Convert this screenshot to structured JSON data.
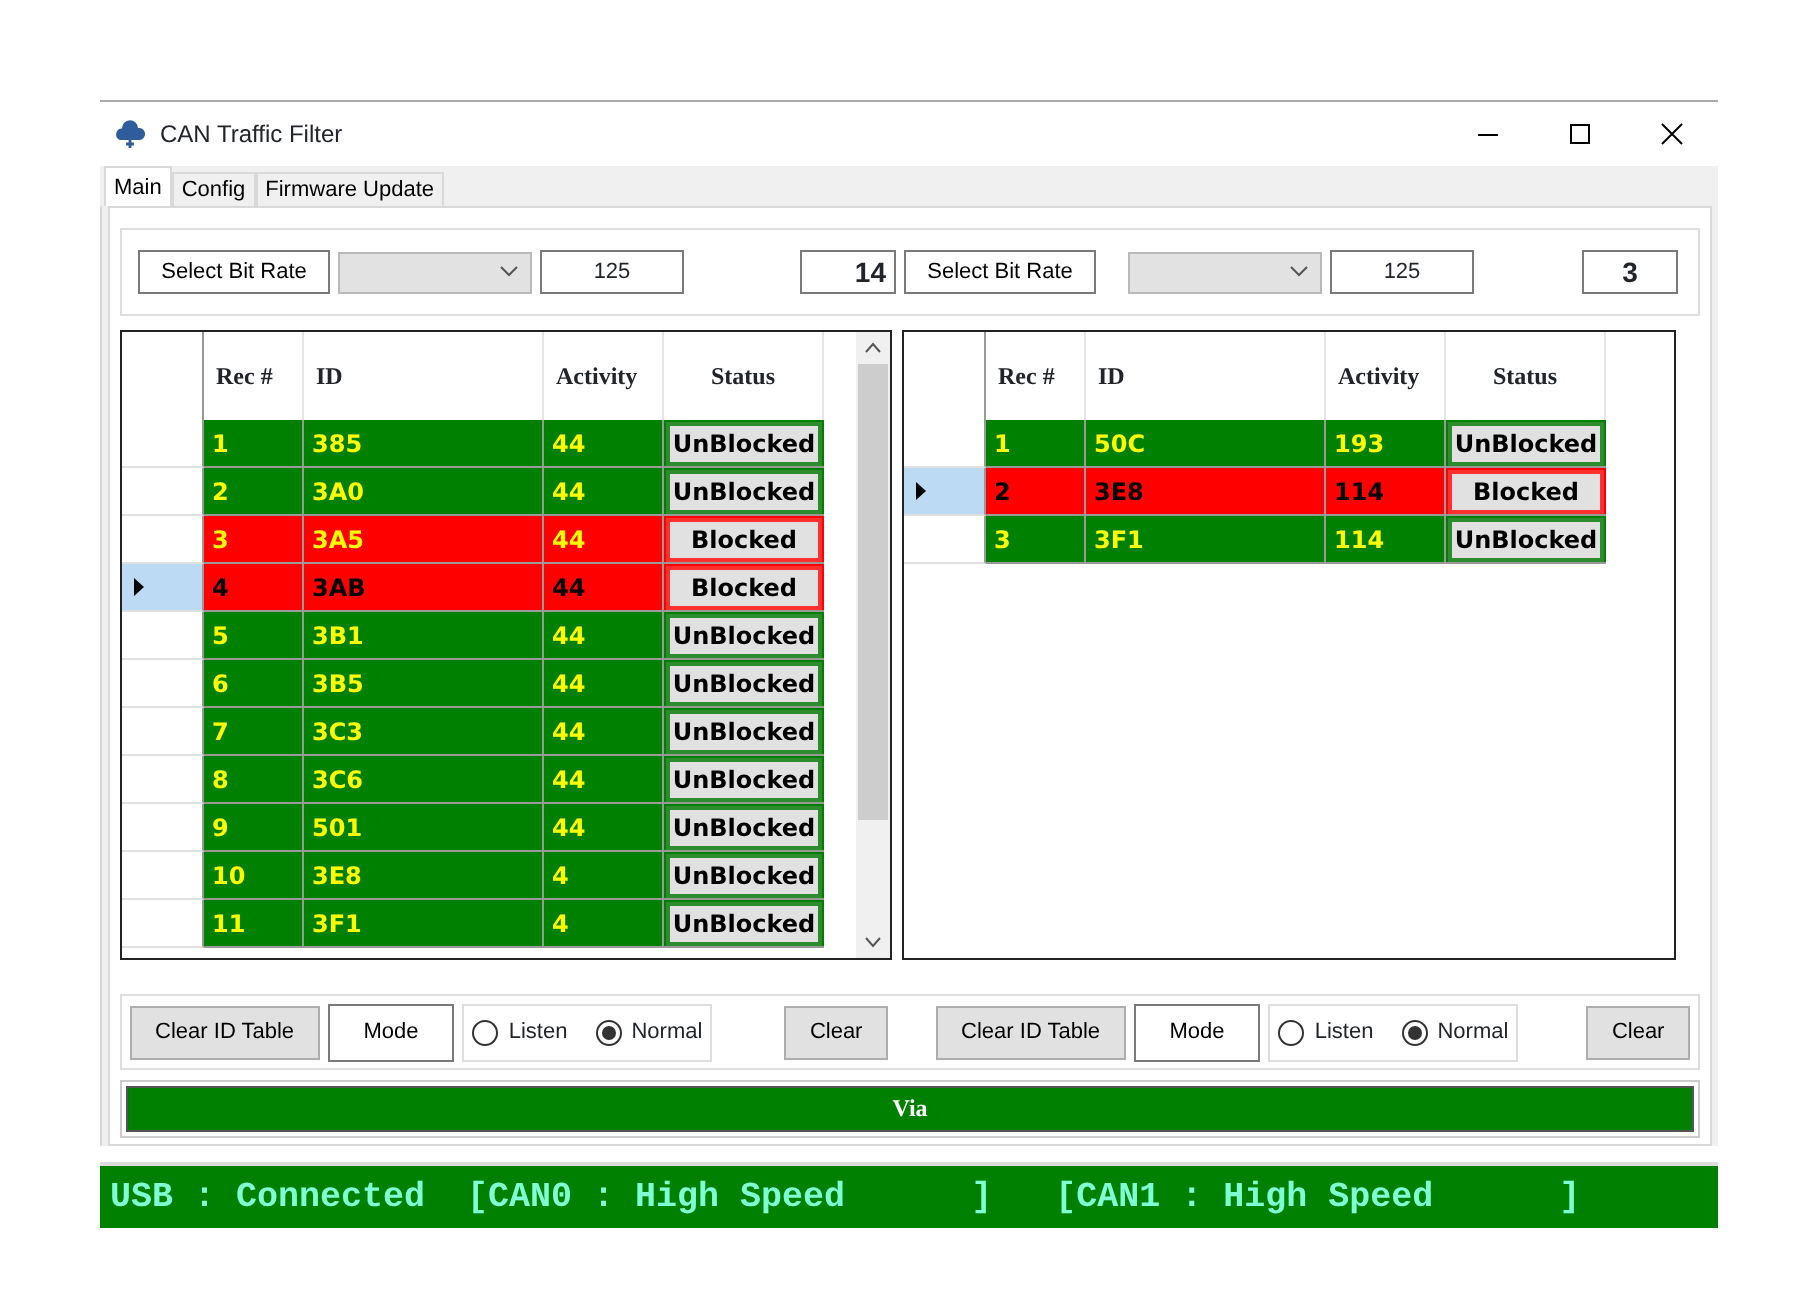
{
  "window": {
    "title": "CAN Traffic Filter"
  },
  "tabs": [
    {
      "label": "Main",
      "selected": true
    },
    {
      "label": "Config",
      "selected": false
    },
    {
      "label": "Firmware Update",
      "selected": false
    }
  ],
  "channels": [
    {
      "bit_rate_button": "Select Bit Rate",
      "rate_value": "125",
      "count": "14",
      "table": {
        "columns": [
          "Rec #",
          "ID",
          "Activity",
          "Status"
        ],
        "rows": [
          {
            "rec": "1",
            "id": "385",
            "activity": "44",
            "status": "UnBlocked",
            "blocked": false,
            "selected": false
          },
          {
            "rec": "2",
            "id": "3A0",
            "activity": "44",
            "status": "UnBlocked",
            "blocked": false,
            "selected": false
          },
          {
            "rec": "3",
            "id": "3A5",
            "activity": "44",
            "status": "Blocked",
            "blocked": true,
            "selected": false
          },
          {
            "rec": "4",
            "id": "3AB",
            "activity": "44",
            "status": "Blocked",
            "blocked": true,
            "selected": true
          },
          {
            "rec": "5",
            "id": "3B1",
            "activity": "44",
            "status": "UnBlocked",
            "blocked": false,
            "selected": false
          },
          {
            "rec": "6",
            "id": "3B5",
            "activity": "44",
            "status": "UnBlocked",
            "blocked": false,
            "selected": false
          },
          {
            "rec": "7",
            "id": "3C3",
            "activity": "44",
            "status": "UnBlocked",
            "blocked": false,
            "selected": false
          },
          {
            "rec": "8",
            "id": "3C6",
            "activity": "44",
            "status": "UnBlocked",
            "blocked": false,
            "selected": false
          },
          {
            "rec": "9",
            "id": "501",
            "activity": "44",
            "status": "UnBlocked",
            "blocked": false,
            "selected": false
          },
          {
            "rec": "10",
            "id": "3E8",
            "activity": "4",
            "status": "UnBlocked",
            "blocked": false,
            "selected": false
          },
          {
            "rec": "11",
            "id": "3F1",
            "activity": "4",
            "status": "UnBlocked",
            "blocked": false,
            "selected": false
          }
        ],
        "scrollable": true
      },
      "clear_table_button": "Clear ID Table",
      "mode_button": "Mode",
      "modes": [
        {
          "label": "Listen",
          "selected": false
        },
        {
          "label": "Normal",
          "selected": true
        }
      ],
      "clear_button": "Clear"
    },
    {
      "bit_rate_button": "Select Bit Rate",
      "rate_value": "125",
      "count": "3",
      "table": {
        "columns": [
          "Rec #",
          "ID",
          "Activity",
          "Status"
        ],
        "rows": [
          {
            "rec": "1",
            "id": "50C",
            "activity": "193",
            "status": "UnBlocked",
            "blocked": false,
            "selected": false
          },
          {
            "rec": "2",
            "id": "3E8",
            "activity": "114",
            "status": "Blocked",
            "blocked": true,
            "selected": true
          },
          {
            "rec": "3",
            "id": "3F1",
            "activity": "114",
            "status": "UnBlocked",
            "blocked": false,
            "selected": false
          }
        ],
        "scrollable": false
      },
      "clear_table_button": "Clear ID Table",
      "mode_button": "Mode",
      "modes": [
        {
          "label": "Listen",
          "selected": false
        },
        {
          "label": "Normal",
          "selected": true
        }
      ],
      "clear_button": "Clear"
    }
  ],
  "via_bar": "Via",
  "status_bar": "USB : Connected  [CAN0 : High Speed      ]   [CAN1 : High Speed      ]"
}
